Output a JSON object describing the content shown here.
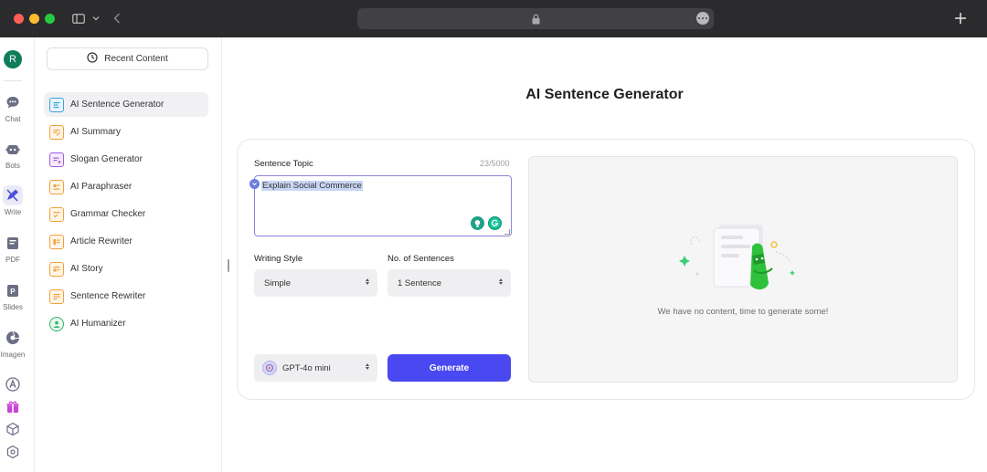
{
  "browser": {
    "icons": [
      "sidebar-toggle-icon",
      "chevron-down-icon",
      "back-icon",
      "lock-icon",
      "more-icon",
      "plus-icon"
    ]
  },
  "rail": {
    "avatar_letter": "R",
    "items": [
      {
        "label": "Chat",
        "icon": "chat-icon"
      },
      {
        "label": "Bots",
        "icon": "bot-icon"
      },
      {
        "label": "Write",
        "icon": "write-icon",
        "active": true
      },
      {
        "label": "PDF",
        "icon": "pdf-icon"
      },
      {
        "label": "Slides",
        "icon": "slides-icon"
      },
      {
        "label": "Imagen",
        "icon": "imagen-icon"
      }
    ],
    "bottom_icons": [
      "app-store-icon",
      "gift-icon",
      "cube-icon",
      "settings-icon"
    ]
  },
  "menu": {
    "recent_label": "Recent Content",
    "items": [
      {
        "label": "AI Sentence Generator",
        "active": true
      },
      {
        "label": "AI Summary"
      },
      {
        "label": "Slogan Generator"
      },
      {
        "label": "AI Paraphraser"
      },
      {
        "label": "Grammar Checker"
      },
      {
        "label": "Article Rewriter"
      },
      {
        "label": "AI Story"
      },
      {
        "label": "Sentence Rewriter"
      },
      {
        "label": "AI Humanizer"
      }
    ]
  },
  "main": {
    "title": "AI Sentence Generator",
    "topic_label": "Sentence Topic",
    "counter": "23/5000",
    "topic_value": "Explain Social Commerce",
    "style_label": "Writing Style",
    "style_value": "Simple",
    "count_label": "No. of Sentences",
    "count_value": "1 Sentence",
    "model_value": "GPT-4o mini",
    "generate_label": "Generate",
    "empty_message": "We have no content, time to generate some!"
  },
  "colors": {
    "accent": "#4a48f0",
    "textarea_border": "#8b86d9",
    "brand_green": "#2fc13b"
  }
}
